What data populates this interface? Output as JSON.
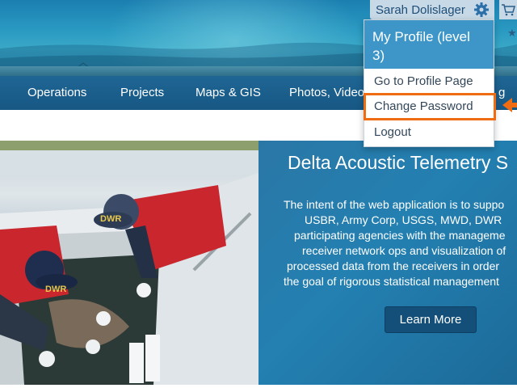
{
  "user_menu": {
    "user_name": "Sarah Dolislager",
    "settings_icon": "gear-icon",
    "cart_icon": "cart-icon"
  },
  "navigation": {
    "items": [
      {
        "label": "Operations"
      },
      {
        "label": "Projects"
      },
      {
        "label": "Maps & GIS"
      },
      {
        "label": "Photos, Video"
      },
      {
        "label": "g"
      }
    ]
  },
  "dropdown": {
    "header": "My Profile (level 3)",
    "items": [
      {
        "label": "Go to Profile Page"
      },
      {
        "label": "Change Password"
      },
      {
        "label": "Logout"
      }
    ]
  },
  "annotation": {
    "highlight_color": "#ef6c13",
    "highlighted_item": "Change Password"
  },
  "hero": {
    "title": "Delta Acoustic Telemetry S",
    "lines": [
      "The intent of the web application is to suppo",
      "USBR, Army Corp, USGS, MWD, DWR",
      "participating agencies with the manageme",
      "receiver network ops and visualization of",
      "processed data from the receivers in order",
      "the goal of rigorous statistical management"
    ],
    "button_label": "Learn More",
    "photo_caps": [
      "DWR",
      "DWR"
    ]
  },
  "colors": {
    "banner": "#2a9ac2",
    "nav": "#175784",
    "dropdown_header": "#3d96c7",
    "hero_panel": "#2380b1",
    "button": "#134f78"
  }
}
